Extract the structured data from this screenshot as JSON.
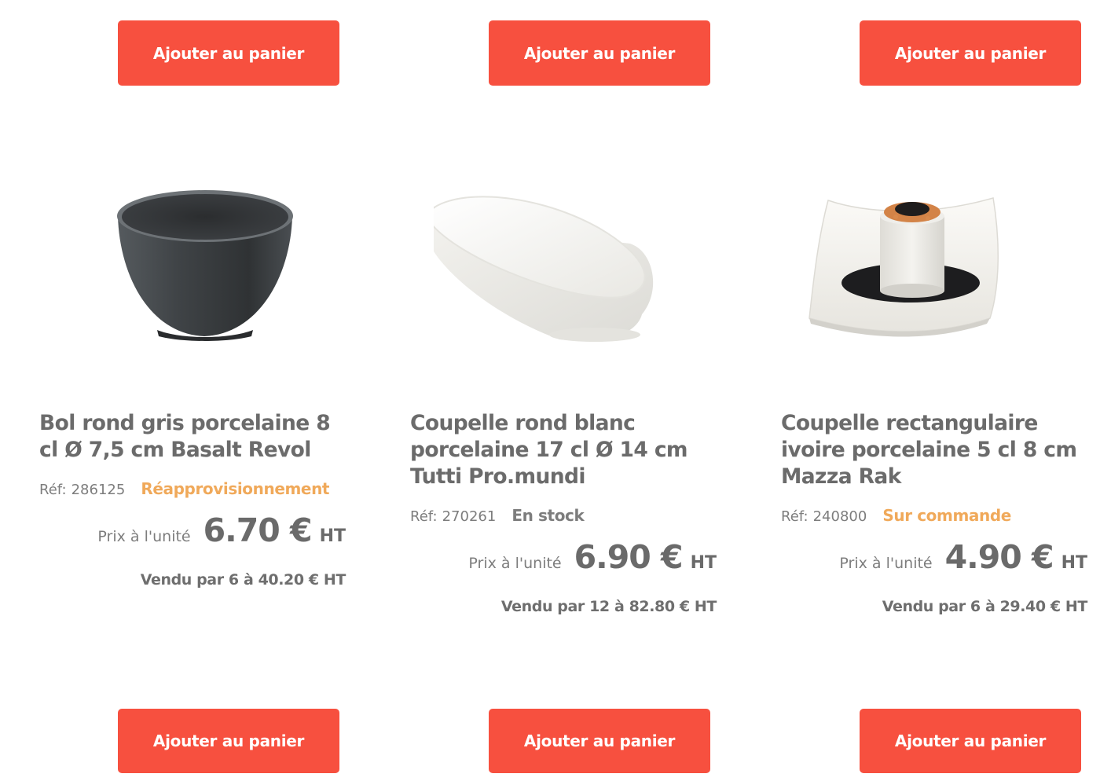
{
  "products": [
    {
      "title": "Bol rond gris porcelaine 8 cl Ø 7,5 cm Basalt Revol",
      "ref_label": "Réf:",
      "ref": "286125",
      "stock": "Réapprovisionnement",
      "stock_color": "#f0a95a",
      "price_label": "Prix à l'unité",
      "price": "6.70 €",
      "price_suffix": "HT",
      "sold_by": "Vendu par 6 à 40.20 € HT",
      "button_top": "Ajouter au panier",
      "button_bottom": "Ajouter au panier",
      "image_icon": "grey-bowl-image"
    },
    {
      "title": "Coupelle rond blanc porcelaine 17 cl Ø 14 cm Tutti Pro.mundi",
      "ref_label": "Réf:",
      "ref": "270261",
      "stock": "En stock",
      "stock_color": "#7d7d7d",
      "price_label": "Prix à l'unité",
      "price": "6.90 €",
      "price_suffix": "HT",
      "sold_by": "Vendu par 12 à 82.80 € HT",
      "button_top": "Ajouter au panier",
      "button_bottom": "Ajouter au panier",
      "image_icon": "white-slanted-bowl-image"
    },
    {
      "title": "Coupelle rectangulaire ivoire porcelaine 5 cl 8 cm Mazza Rak",
      "ref_label": "Réf:",
      "ref": "240800",
      "stock": "Sur commande",
      "stock_color": "#f0a95a",
      "price_label": "Prix à l'unité",
      "price": "4.90 €",
      "price_suffix": "HT",
      "sold_by": "Vendu par 6 à 29.40 € HT",
      "button_top": "Ajouter au panier",
      "button_bottom": "Ajouter au panier",
      "image_icon": "square-plate-image"
    }
  ],
  "colors": {
    "button": "#f7503f",
    "title": "#6b6b6b",
    "accent_stock": "#f0a95a"
  }
}
